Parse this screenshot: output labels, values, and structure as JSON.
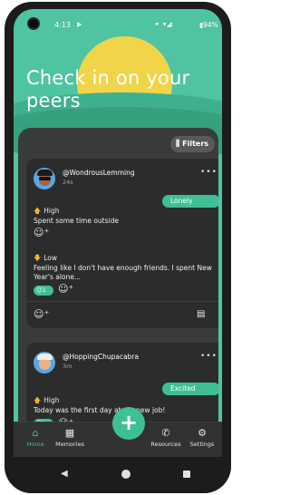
{
  "status_bar": {
    "time": "4:13",
    "battery": "94%"
  },
  "header": {
    "title": "Check in on your peers",
    "filters_label": "Filters"
  },
  "posts": [
    {
      "username": "@WondrousLemming",
      "ago": "24s",
      "mood": "Lonely",
      "entries": [
        {
          "level": "High",
          "text": "Spent some time outside"
        },
        {
          "level": "Low",
          "text": "Feeling like I don't have enough friends. I spent New Year's alone..."
        }
      ],
      "reaction_count": "1"
    },
    {
      "username": "@HoppingChupacabra",
      "ago": "3m",
      "mood": "Excited",
      "entries": [
        {
          "level": "High",
          "text": "Today was the first day at my new job!"
        }
      ],
      "reaction_count": "1"
    }
  ],
  "nav": {
    "items": [
      {
        "label": "Home",
        "icon": "home-icon"
      },
      {
        "label": "Memories",
        "icon": "calendar-icon"
      },
      {
        "label": "Resources",
        "icon": "phone-icon"
      },
      {
        "label": "Settings",
        "icon": "gear-icon"
      }
    ],
    "fab_label": "+"
  },
  "colors": {
    "accent": "#3fbf95",
    "header_bg": "#4fc4a2",
    "sun": "#f1d549",
    "card_bg": "#2b2d2c",
    "level_arrow": "#f2b62f"
  }
}
